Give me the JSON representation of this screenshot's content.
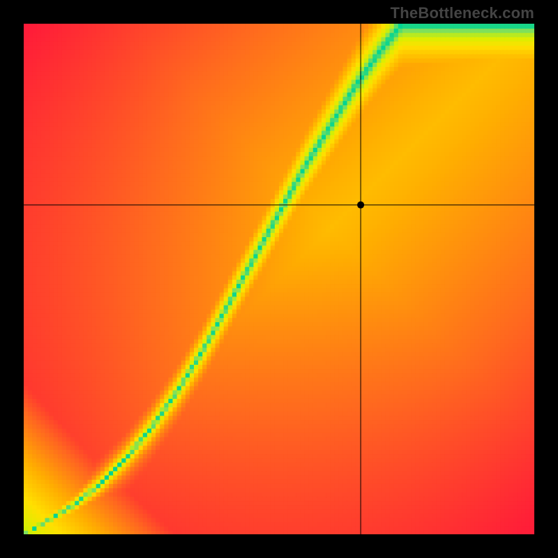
{
  "watermark": "TheBottleneck.com",
  "chart_data": {
    "type": "heatmap",
    "title": "",
    "xlabel": "",
    "ylabel": "",
    "xlim": [
      0,
      1
    ],
    "ylim": [
      0,
      1
    ],
    "grid_resolution": 120,
    "marker": {
      "x": 0.66,
      "y": 0.645
    },
    "crosshair": {
      "x": 0.66,
      "y": 0.645
    },
    "optimal_ridge": [
      {
        "x": 0.0,
        "y": 0.0
      },
      {
        "x": 0.05,
        "y": 0.03
      },
      {
        "x": 0.1,
        "y": 0.06
      },
      {
        "x": 0.15,
        "y": 0.1
      },
      {
        "x": 0.2,
        "y": 0.15
      },
      {
        "x": 0.25,
        "y": 0.21
      },
      {
        "x": 0.3,
        "y": 0.28
      },
      {
        "x": 0.35,
        "y": 0.36
      },
      {
        "x": 0.4,
        "y": 0.45
      },
      {
        "x": 0.45,
        "y": 0.54
      },
      {
        "x": 0.5,
        "y": 0.63
      },
      {
        "x": 0.55,
        "y": 0.72
      },
      {
        "x": 0.6,
        "y": 0.8
      },
      {
        "x": 0.65,
        "y": 0.88
      },
      {
        "x": 0.7,
        "y": 0.95
      },
      {
        "x": 0.74,
        "y": 1.0
      }
    ],
    "ridge_width_profile": [
      {
        "x": 0.0,
        "half_width": 0.01
      },
      {
        "x": 0.1,
        "half_width": 0.014
      },
      {
        "x": 0.2,
        "half_width": 0.02
      },
      {
        "x": 0.3,
        "half_width": 0.028
      },
      {
        "x": 0.4,
        "half_width": 0.038
      },
      {
        "x": 0.5,
        "half_width": 0.048
      },
      {
        "x": 0.6,
        "half_width": 0.058
      },
      {
        "x": 0.7,
        "half_width": 0.068
      },
      {
        "x": 0.74,
        "half_width": 0.074
      }
    ],
    "color_scale": [
      {
        "score": 0.0,
        "color": "#ff1a3a"
      },
      {
        "score": 0.25,
        "color": "#ff6a1f"
      },
      {
        "score": 0.5,
        "color": "#ffb000"
      },
      {
        "score": 0.7,
        "color": "#ffe000"
      },
      {
        "score": 0.85,
        "color": "#d8f000"
      },
      {
        "score": 0.95,
        "color": "#7be060"
      },
      {
        "score": 1.0,
        "color": "#00d493"
      }
    ],
    "corner_field_values": {
      "bottom_left": 0.95,
      "bottom_right": 0.0,
      "top_left": 0.0,
      "top_right": 0.55
    }
  }
}
